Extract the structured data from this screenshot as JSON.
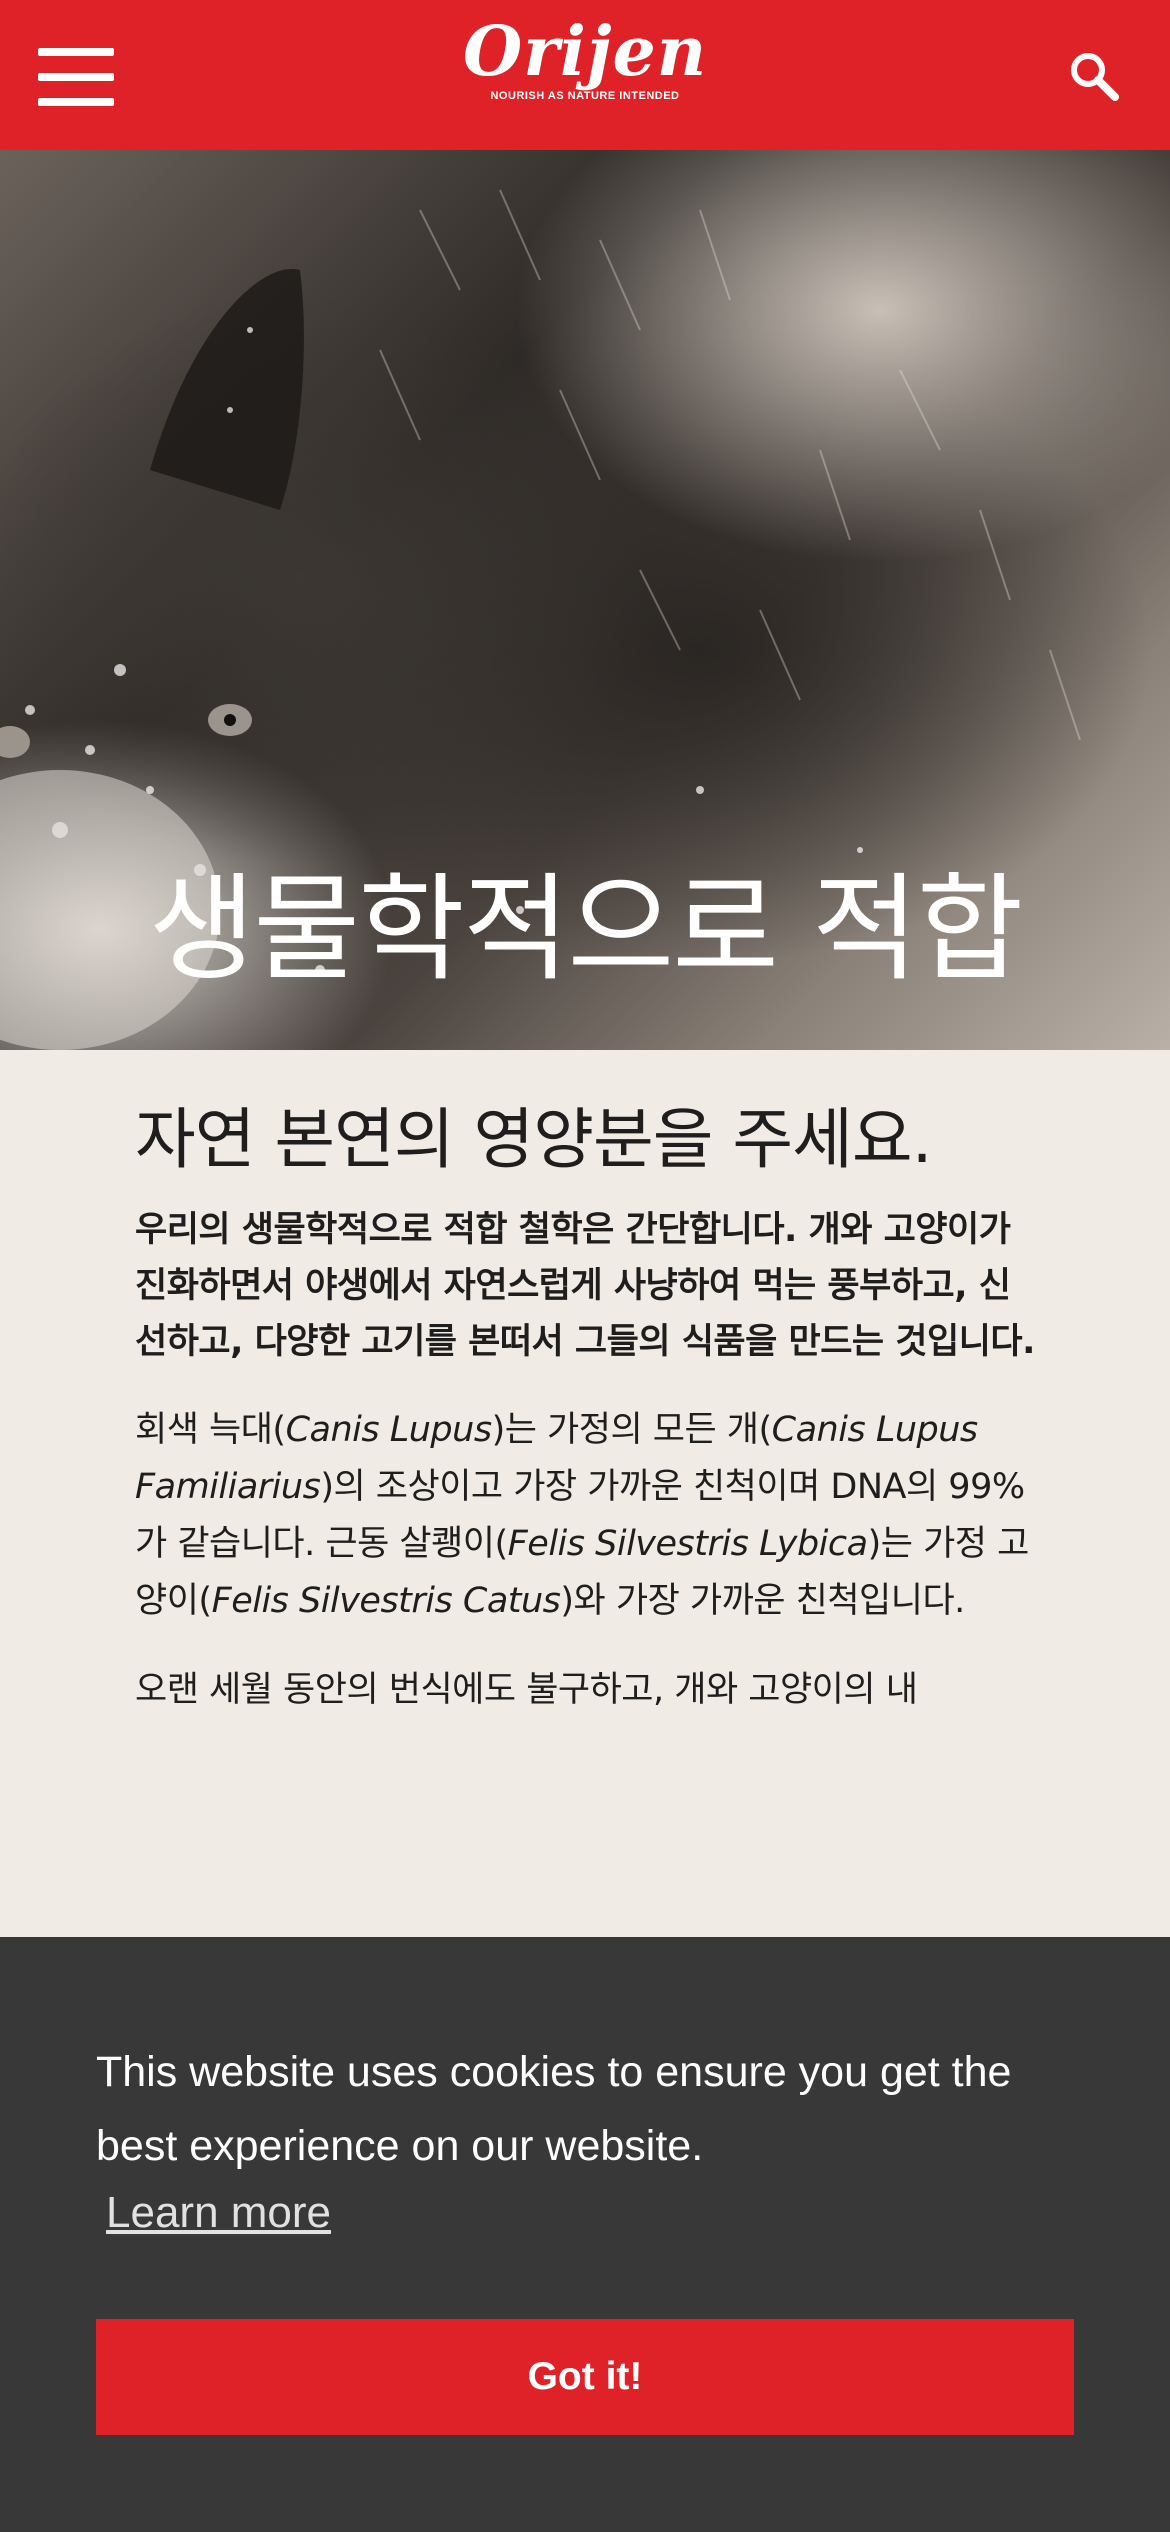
{
  "header": {
    "logo_text": "Orijen",
    "logo_tagline": "NOURISH AS NATURE INTENDED",
    "colors": {
      "brand": "#df2228"
    },
    "menu_icon": "hamburger-menu-icon",
    "search_icon": "search-icon"
  },
  "hero": {
    "title": "생물학적으로 적합"
  },
  "content": {
    "heading": "자연 본연의 영양분을 주세요.",
    "lead": "우리의 생물학적으로 적합 철학은 간단합니다. 개와 고양이가 진화하면서 야생에서 자연스럽게 사냥하여 먹는 풍부하고, 신선하고, 다양한 고기를 본떠서 그들의 식품을 만드는 것입니다.",
    "paragraph1": {
      "p1": "회색 늑대(",
      "i1": "Canis Lupus",
      "p2": ")는 가정의 모든 개(",
      "i2": "Canis Lupus Familiarius",
      "p3": ")의 조상이고 가장 가까운 친척이며 DNA의 99%가 같습니다. 근동 살쾡이(",
      "i3": "Felis Silvestris Lybica",
      "p4": ")는 가정 고양이(",
      "i4": "Felis Silvestris Catus",
      "p5": ")와 가장 가까운 친척입니다."
    },
    "paragraph2": "오랜 세월 동안의 번식에도 불구하고, 개와 고양이의 내"
  },
  "cookie_banner": {
    "message": "This website uses cookies to ensure you get the best experience on our website.",
    "learn_more": "Learn more",
    "accept_label": "Got it!"
  }
}
